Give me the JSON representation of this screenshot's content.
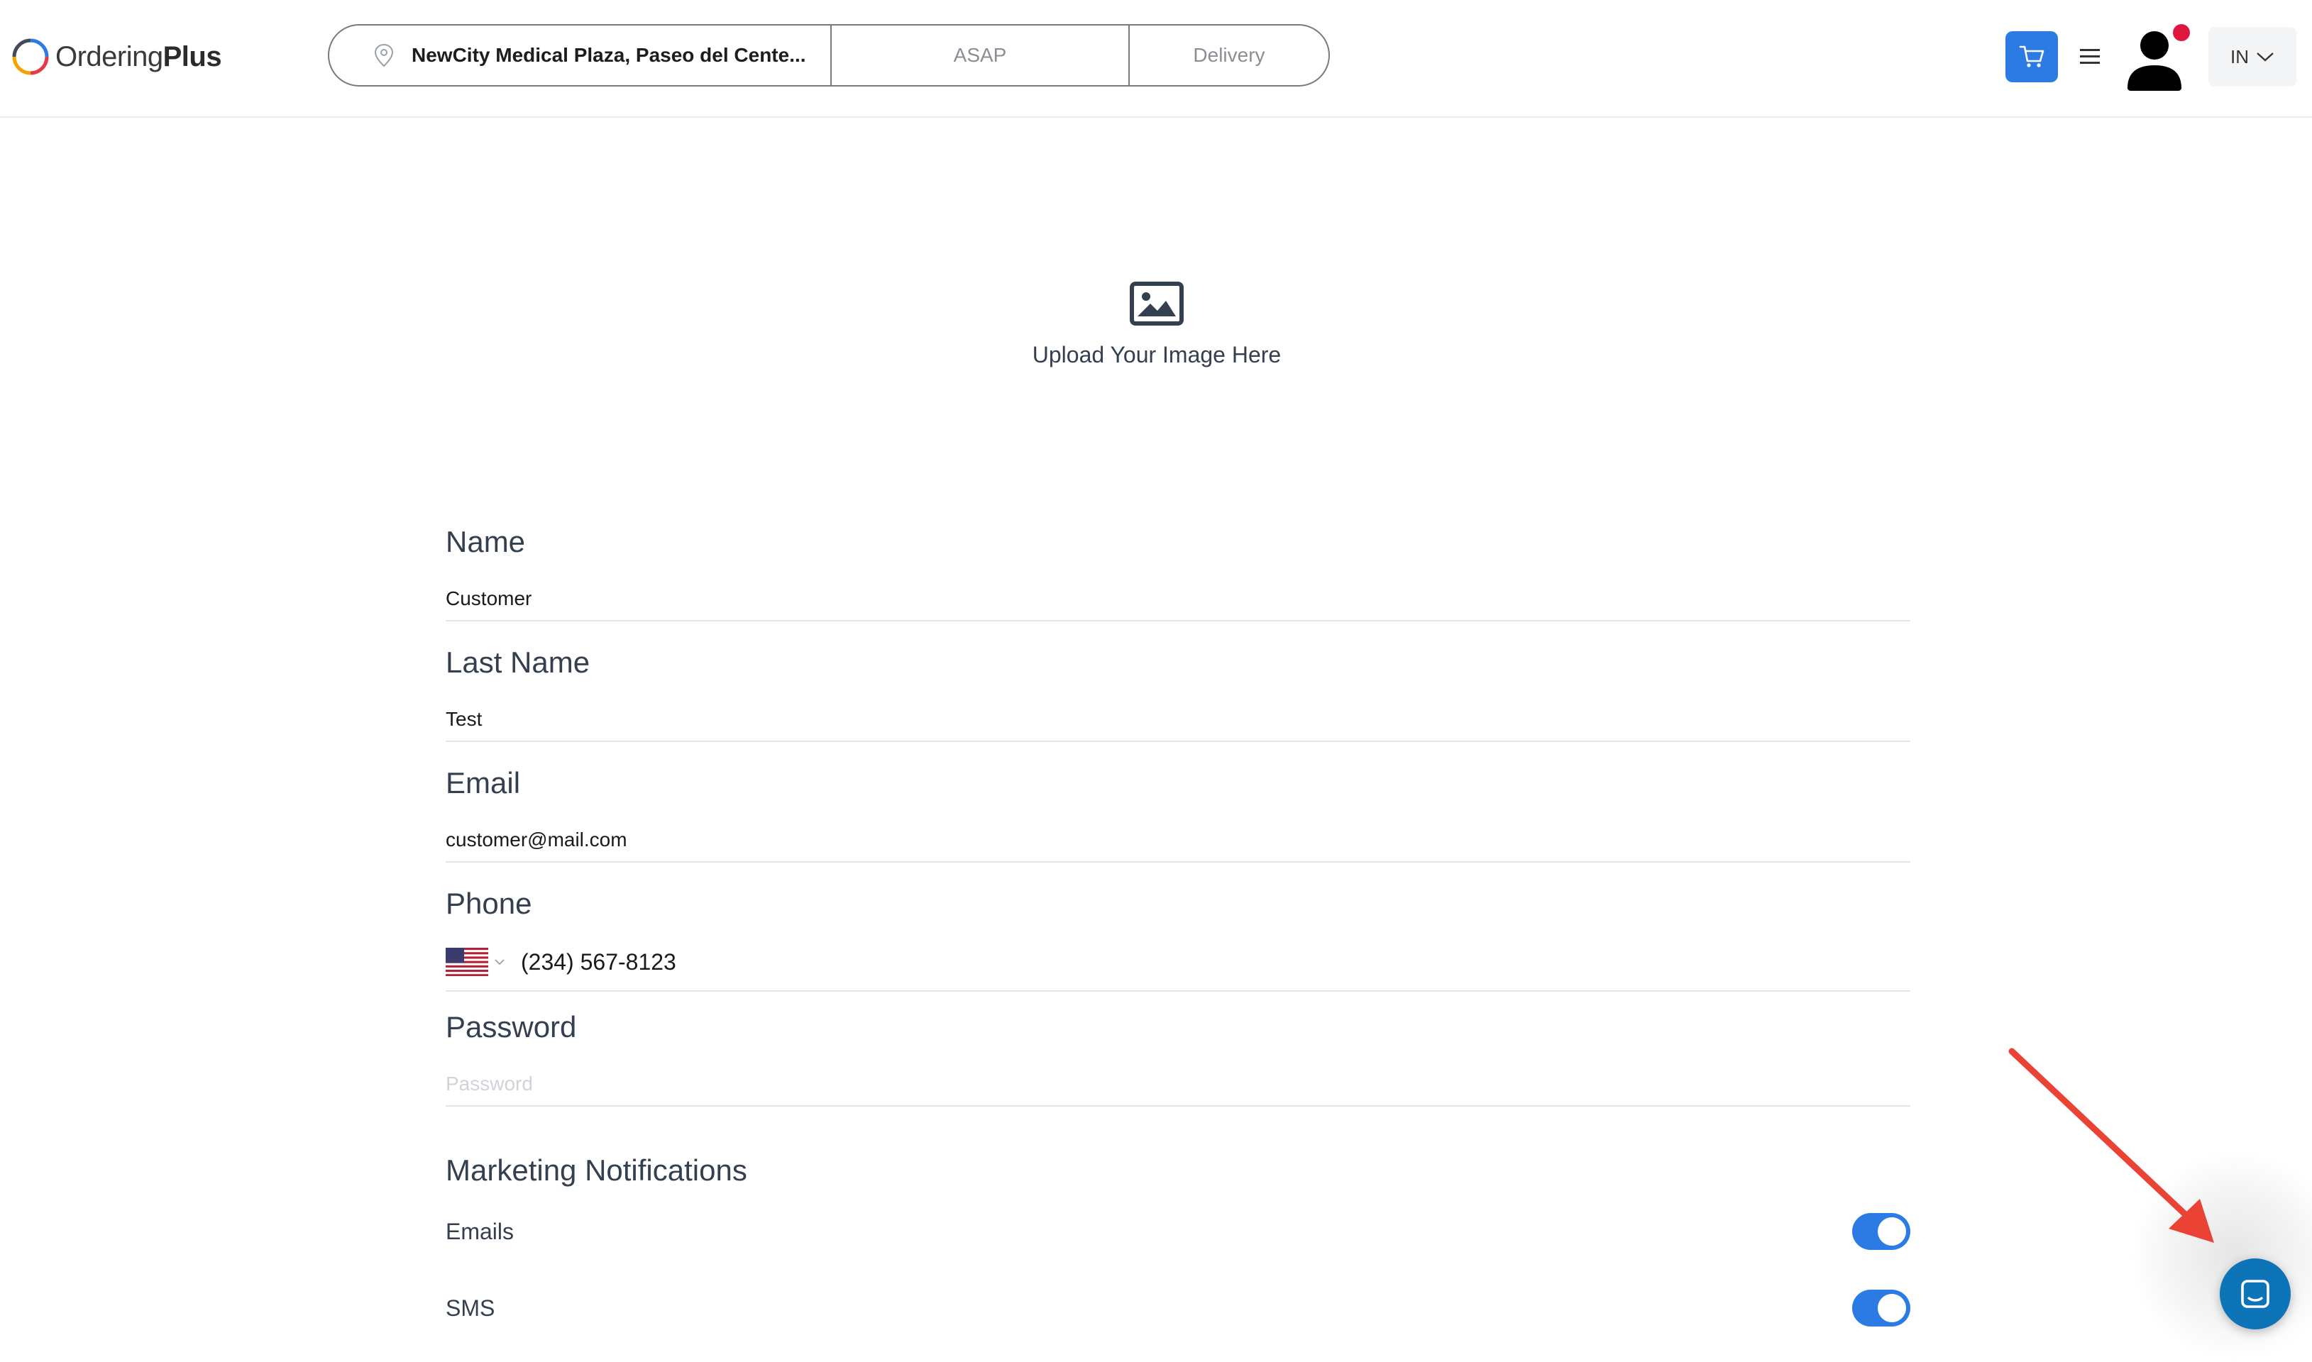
{
  "header": {
    "logo_prefix": "Ordering",
    "logo_suffix": "Plus",
    "address": "NewCity Medical Plaza, Paseo del Cente...",
    "time": "ASAP",
    "order_type": "Delivery",
    "language": "IN",
    "icons": [
      "location-pin-icon",
      "cart-icon",
      "hamburger-menu-icon",
      "user-avatar-icon",
      "chevron-down-icon"
    ],
    "accent_color": "#2c7be5",
    "notification_color": "#e0163f"
  },
  "upload": {
    "label": "Upload Your Image Here",
    "icon": "image-icon"
  },
  "form": {
    "name": {
      "label": "Name",
      "value": "Customer"
    },
    "last_name": {
      "label": "Last Name",
      "value": "Test"
    },
    "email": {
      "label": "Email",
      "value": "customer@mail.com"
    },
    "phone": {
      "label": "Phone",
      "value": "(234) 567-8123",
      "country_icon": "us-flag-icon"
    },
    "password": {
      "label": "Password",
      "value": "",
      "placeholder": "Password"
    }
  },
  "marketing": {
    "title": "Marketing Notifications",
    "options": [
      {
        "label": "Emails",
        "enabled": true
      },
      {
        "label": "SMS",
        "enabled": true
      }
    ]
  },
  "chat": {
    "icon": "chat-icon",
    "color": "#0d74b8"
  },
  "annotation": {
    "arrow_color": "#ea4335"
  }
}
